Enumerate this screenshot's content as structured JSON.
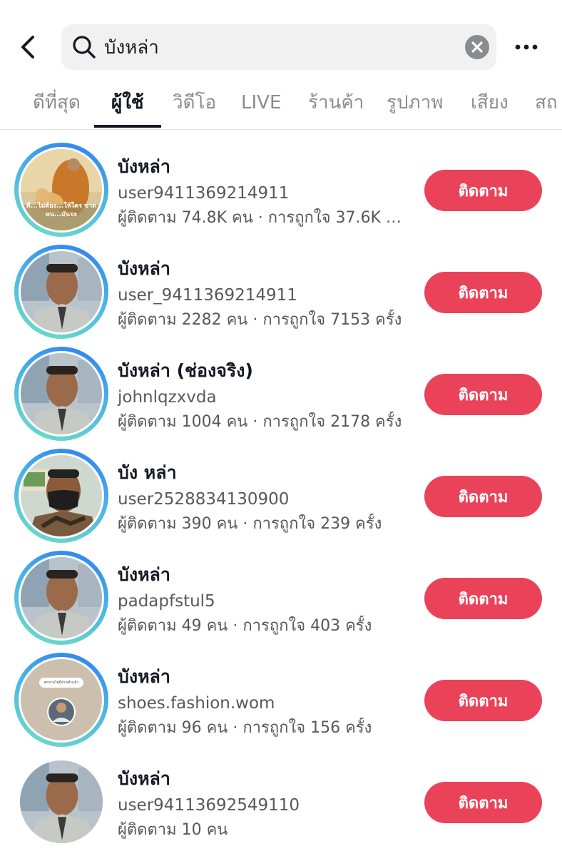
{
  "search": {
    "query": "บังหล่า"
  },
  "tabs": [
    {
      "label": "ดีที่สุด"
    },
    {
      "label": "ผู้ใช้"
    },
    {
      "label": "วิดีโอ"
    },
    {
      "label": "LIVE"
    },
    {
      "label": "ร้านค้า"
    },
    {
      "label": "รูปภาพ"
    },
    {
      "label": "เสียง"
    },
    {
      "label": "สถ"
    }
  ],
  "active_tab": "ผู้ใช้",
  "follow_label": "ติดตาม",
  "colors": {
    "accent": "#ea4359",
    "text_primary": "#161823",
    "text_secondary": "#57585e",
    "ring_gradient": [
      "#2b7cf2",
      "#6fe0c6"
    ]
  },
  "users": [
    {
      "name": "บังหล่า",
      "handle": "user9411369214911",
      "stats": "ผู้ติดตาม 74.8K คน · การถูกใจ 37.6K ค...",
      "avatar": "monk-with-dog-avatar",
      "avatar_caption": "ดี...ไม่ต้อง...ให้ใคร ขาดคน...มันจะ",
      "ring": true
    },
    {
      "name": "บังหล่า",
      "handle": "user_9411369214911",
      "stats": "ผู้ติดตาม 2282 คน · การถูกใจ 7153 ครั้ง",
      "avatar": "man-in-uniform-avatar",
      "ring": true
    },
    {
      "name": "บังหล่า (ช่องจริง)",
      "handle": "johnlqzxvda",
      "stats": "ผู้ติดตาม 1004 คน · การถูกใจ 2178 ครั้ง",
      "avatar": "man-in-uniform-avatar",
      "ring": true
    },
    {
      "name": "บัง หล่า",
      "handle": "user2528834130900",
      "stats": "ผู้ติดตาม 390 คน · การถูกใจ 239 ครั้ง",
      "avatar": "man-with-mask-avatar",
      "ring": true
    },
    {
      "name": "บังหล่า",
      "handle": "padapfstul5",
      "stats": "ผู้ติดตาม 49 คน · การถูกใจ 403 ครั้ง",
      "avatar": "man-in-uniform-avatar",
      "ring": true
    },
    {
      "name": "บังหล่า",
      "handle": "shoes.fashion.wom",
      "stats": "ผู้ติดตาม 96 คน · การถูกใจ 156 ครั้ง",
      "avatar": "beige-post-avatar",
      "avatar_caption": "ตกงานไม่มีงานทำแล้ว",
      "ring": true
    },
    {
      "name": "บังหล่า",
      "handle": "user94113692549110",
      "stats": "ผู้ติดตาม 10 คน",
      "avatar": "man-in-uniform-avatar",
      "ring": false
    }
  ]
}
